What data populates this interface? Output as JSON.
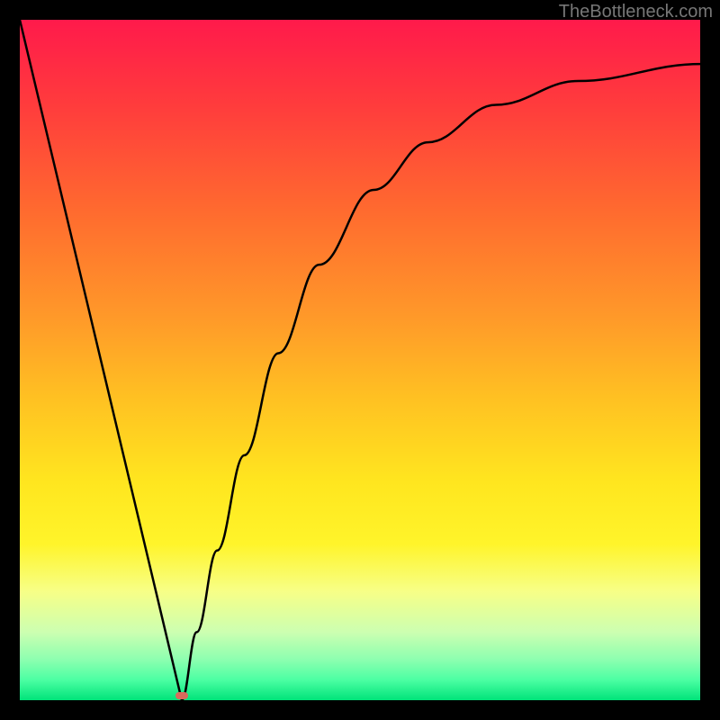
{
  "attribution": "TheBottleneck.com",
  "chart_data": {
    "type": "line",
    "title": "",
    "xlabel": "",
    "ylabel": "",
    "x_range": [
      0,
      1
    ],
    "y_range": [
      0,
      1
    ],
    "grid": false,
    "legend": false,
    "background_gradient": {
      "top_color": "#ff1a4b",
      "bottom_color": "#00e37a"
    },
    "series": [
      {
        "name": "left-descent",
        "x": [
          0.0,
          0.05,
          0.1,
          0.15,
          0.2,
          0.238
        ],
        "values": [
          1.0,
          0.79,
          0.58,
          0.37,
          0.16,
          0.0
        ]
      },
      {
        "name": "right-ascent",
        "x": [
          0.238,
          0.26,
          0.29,
          0.33,
          0.38,
          0.44,
          0.52,
          0.6,
          0.7,
          0.82,
          1.0
        ],
        "values": [
          0.0,
          0.1,
          0.22,
          0.36,
          0.51,
          0.64,
          0.75,
          0.82,
          0.875,
          0.91,
          0.935
        ]
      }
    ],
    "minimum_marker": {
      "x": 0.238,
      "y": 0.0,
      "color": "#d96a5c"
    }
  }
}
